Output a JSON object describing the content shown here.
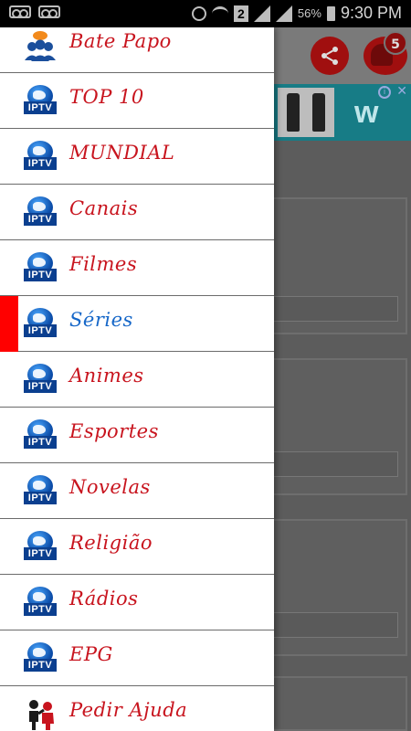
{
  "status_bar": {
    "battery_percent": "56%",
    "time": "9:30 PM",
    "sim_label": "2",
    "icons": [
      "voicemail-icon",
      "voicemail-icon",
      "alarm-icon",
      "wifi-icon",
      "sim-icon",
      "signal-icon",
      "signal-icon",
      "battery-icon"
    ]
  },
  "background_app": {
    "notification_count": "5",
    "accent_color": "#b00000",
    "icons": [
      "share-icon",
      "bell-icon"
    ]
  },
  "drawer": {
    "label_color": "#c8141e",
    "selected_label_color": "#1667c8",
    "selected_indicator_color": "#ff0000",
    "items": [
      {
        "label": "Bate Papo",
        "icon": "chat-group-icon"
      },
      {
        "label": "TOP 10",
        "icon": "iptv-globe-icon"
      },
      {
        "label": "MUNDIAL",
        "icon": "iptv-globe-icon"
      },
      {
        "label": "Canais",
        "icon": "iptv-globe-icon"
      },
      {
        "label": "Filmes",
        "icon": "iptv-globe-icon"
      },
      {
        "label": "Séries",
        "icon": "iptv-globe-icon",
        "selected": true
      },
      {
        "label": "Animes",
        "icon": "iptv-globe-icon"
      },
      {
        "label": "Esportes",
        "icon": "iptv-globe-icon"
      },
      {
        "label": "Novelas",
        "icon": "iptv-globe-icon"
      },
      {
        "label": "Religião",
        "icon": "iptv-globe-icon"
      },
      {
        "label": "Rádios",
        "icon": "iptv-globe-icon"
      },
      {
        "label": "EPG",
        "icon": "iptv-globe-icon"
      },
      {
        "label": "Pedir Ajuda",
        "icon": "help-people-icon"
      }
    ],
    "iptv_icon_text": "IPTV"
  }
}
